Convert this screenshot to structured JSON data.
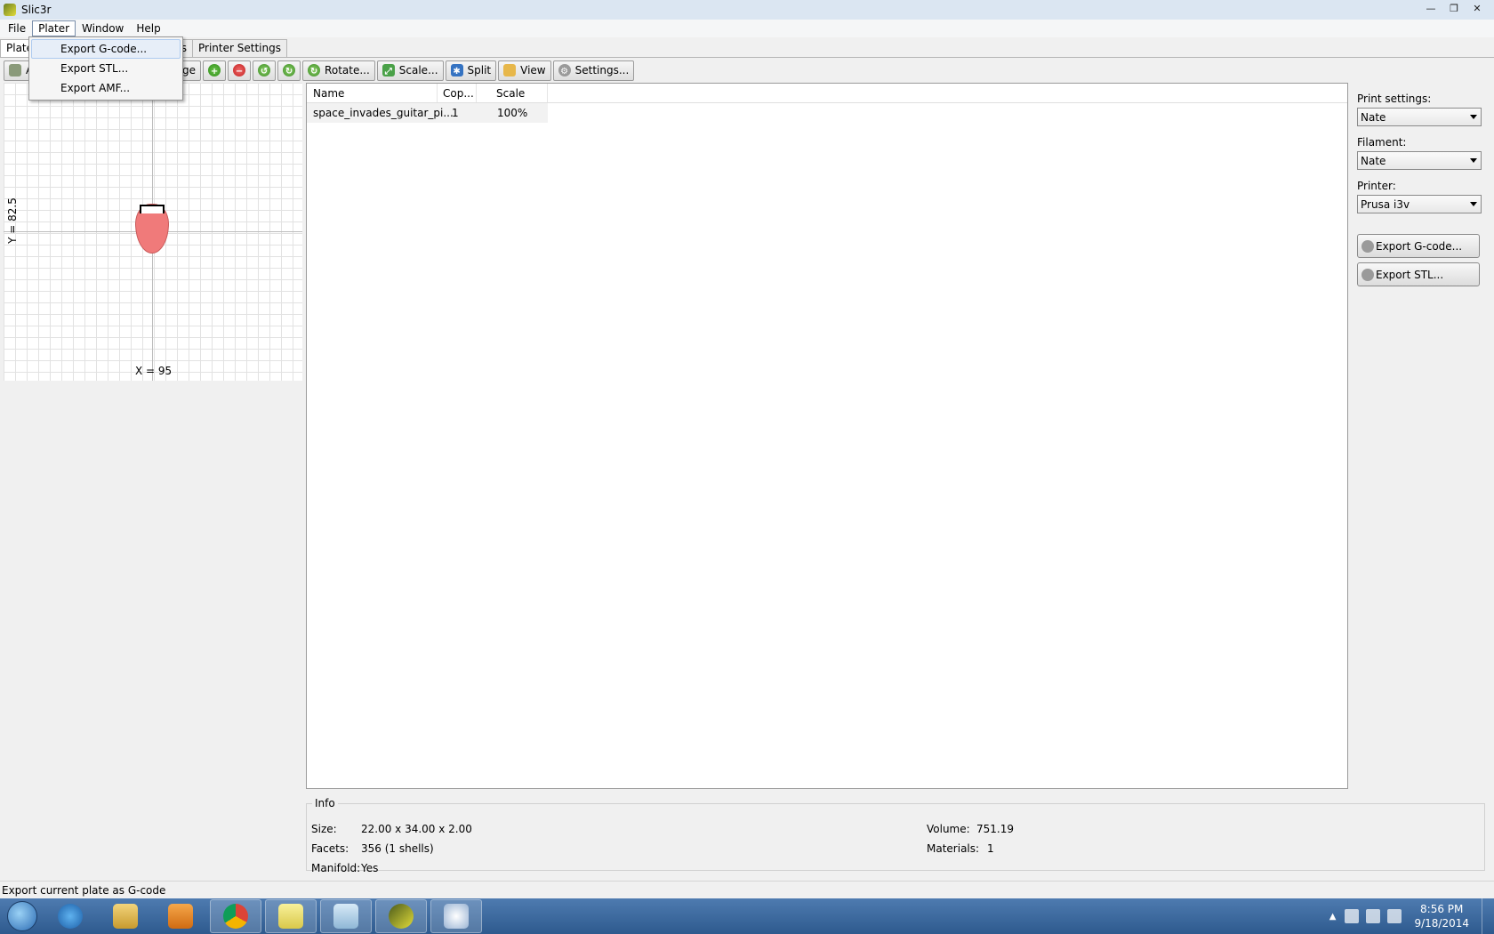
{
  "window": {
    "title": "Slic3r"
  },
  "menubar": {
    "items": [
      "File",
      "Plater",
      "Window",
      "Help"
    ]
  },
  "tabs": [
    "Plater",
    "ings",
    "Printer Settings"
  ],
  "plater_menu": {
    "items": [
      "Export G-code...",
      "Export STL...",
      "Export AMF..."
    ]
  },
  "toolbar": {
    "add_label": "A",
    "all_label": "ll",
    "arrange_label": "Arrange",
    "rotate_label": "Rotate...",
    "scale_label": "Scale...",
    "split_label": "Split",
    "view_label": "View",
    "settings_label": "Settings..."
  },
  "canvas": {
    "x_label": "X = 95",
    "y_label": "Y = 82.5"
  },
  "object_list": {
    "headers": [
      "Name",
      "Cop...",
      "Scale"
    ],
    "rows": [
      {
        "name": "space_invades_guitar_pi...",
        "copies": "1",
        "scale": "100%"
      }
    ]
  },
  "right_panel": {
    "print_settings_label": "Print settings:",
    "print_settings_value": "Nate",
    "filament_label": "Filament:",
    "filament_value": "Nate",
    "printer_label": "Printer:",
    "printer_value": "Prusa i3v",
    "export_gcode_label": "Export G-code...",
    "export_stl_label": "Export STL..."
  },
  "info": {
    "legend": "Info",
    "size_label": "Size:",
    "size_value": "22.00 x 34.00 x 2.00",
    "facets_label": "Facets:",
    "facets_value": "356 (1 shells)",
    "manifold_label": "Manifold:",
    "manifold_value": "Yes",
    "volume_label": "Volume:",
    "volume_value": "751.19",
    "materials_label": "Materials:",
    "materials_value": "1"
  },
  "status": {
    "text": "Export current plate as G-code"
  },
  "taskbar": {
    "time": "8:56 PM",
    "date": "9/18/2014",
    "apps": [
      "internet-explorer-icon",
      "file-explorer-icon",
      "media-player-icon",
      "chrome-icon",
      "sticky-notes-icon",
      "notepad-icon",
      "slic3r-icon",
      "paint-icon"
    ]
  }
}
